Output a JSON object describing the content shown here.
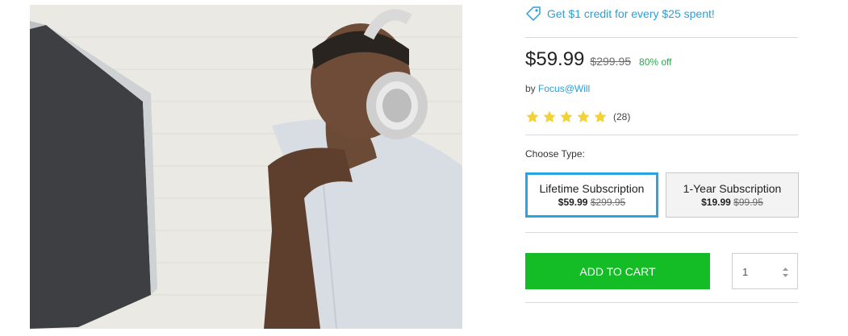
{
  "promo": {
    "icon": "tag-icon",
    "text": "Get $1 credit for every $25 spent!"
  },
  "product": {
    "image_alt": "man-with-headphones-at-computer",
    "price": "$59.99",
    "original_price": "$299.95",
    "discount": "80% off",
    "by_label": "by",
    "vendor": "Focus@Will",
    "rating": {
      "stars": 5,
      "max": 5,
      "count": "(28)",
      "star_color": "#f5d234"
    }
  },
  "choose_type": {
    "label": "Choose Type:",
    "options": [
      {
        "title": "Lifetime Subscription",
        "price": "$59.99",
        "original_price": "$299.95",
        "selected": true
      },
      {
        "title": "1-Year Subscription",
        "price": "$19.99",
        "original_price": "$99.95",
        "selected": false
      }
    ]
  },
  "cart": {
    "add_label": "ADD TO CART",
    "quantity": "1"
  },
  "colors": {
    "accent": "#2aa3e0",
    "cta": "#14bd26",
    "discount": "#2ea44f"
  }
}
